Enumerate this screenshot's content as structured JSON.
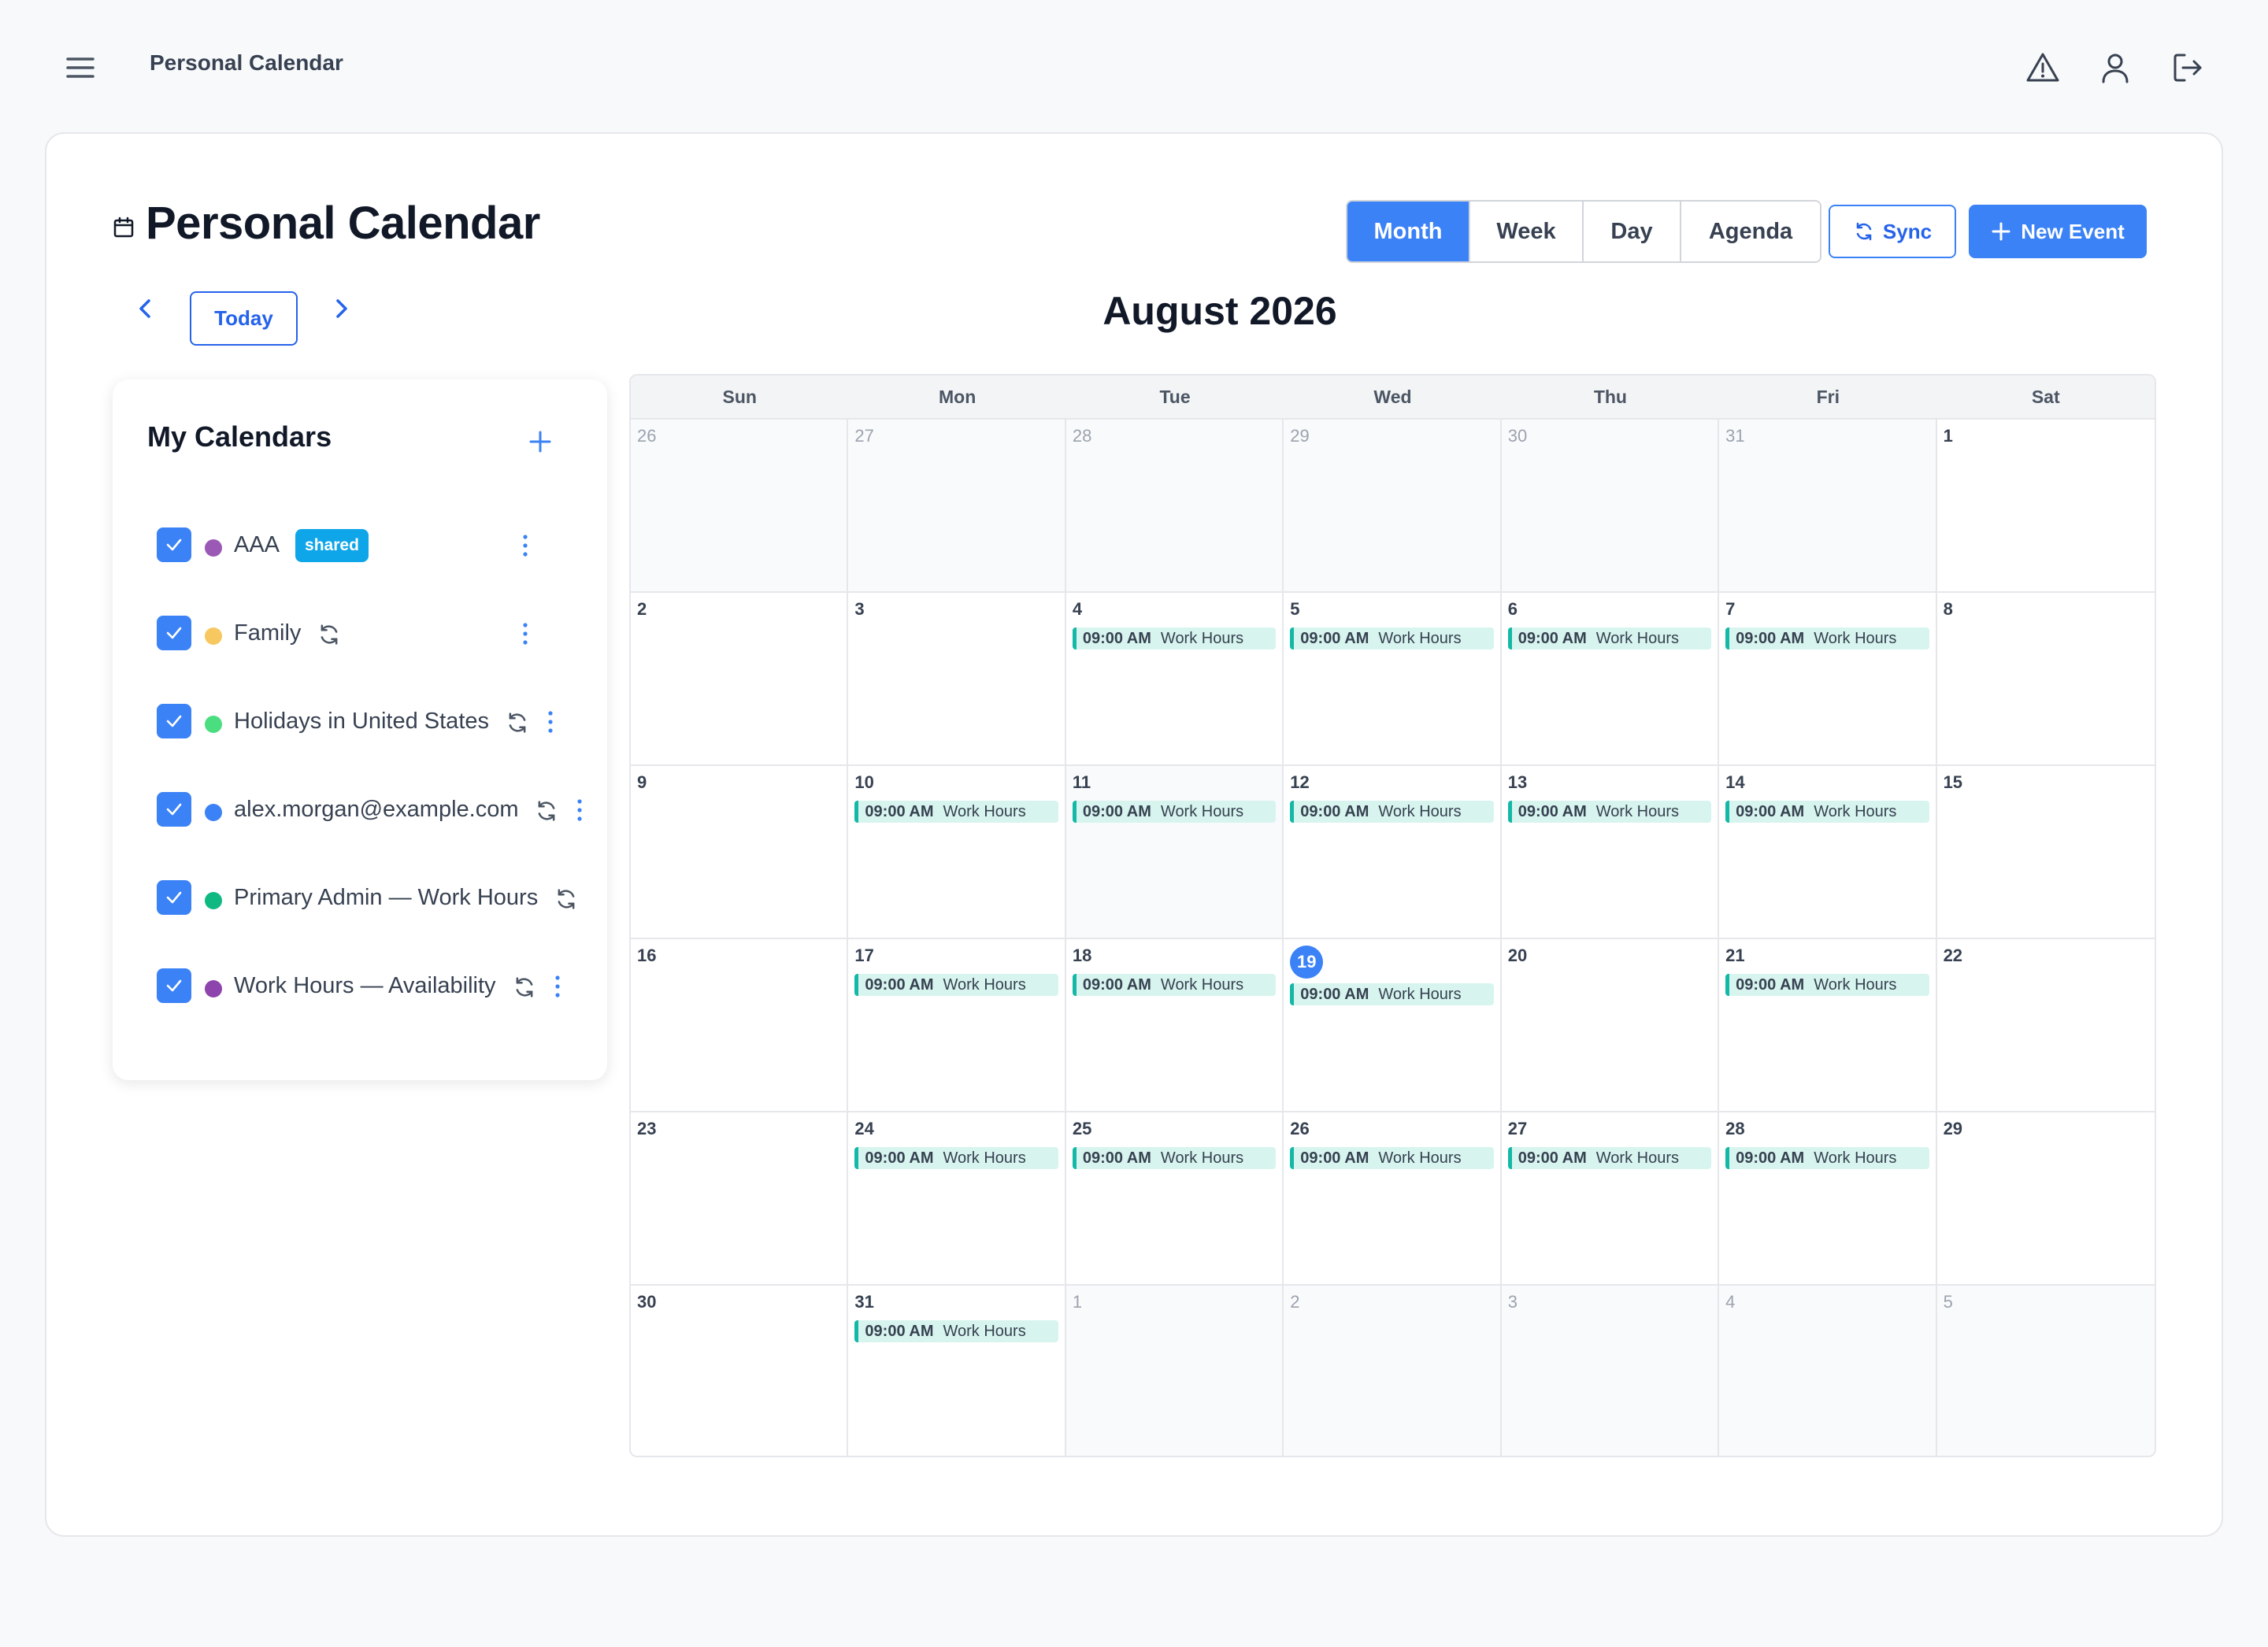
{
  "topbar": {
    "app_title": "Personal Calendar",
    "icons": [
      "menu-icon",
      "warning-icon",
      "user-icon",
      "logout-icon"
    ]
  },
  "header": {
    "page_title": "Personal Calendar",
    "today_label": "Today",
    "month_label": "August 2026",
    "views": [
      {
        "label": "Month",
        "active": true
      },
      {
        "label": "Week",
        "active": false
      },
      {
        "label": "Day",
        "active": false
      },
      {
        "label": "Agenda",
        "active": false
      }
    ],
    "sync_label": "Sync",
    "new_event_label": "New Event"
  },
  "sidebar": {
    "title": "My Calendars",
    "calendars": [
      {
        "name": "AAA",
        "color": "#9b59b6",
        "checked": true,
        "badge": "shared",
        "sync": false,
        "more": true
      },
      {
        "name": "Family",
        "color": "#f6c85f",
        "checked": true,
        "badge": null,
        "sync": true,
        "more": true
      },
      {
        "name": "Holidays in United States",
        "color": "#4ade80",
        "checked": true,
        "badge": null,
        "sync": true,
        "more": true
      },
      {
        "name": "alex.morgan@example.com",
        "color": "#3b82f6",
        "checked": true,
        "badge": null,
        "sync": true,
        "more": true
      },
      {
        "name": "Primary Admin — Work Hours",
        "color": "#10b981",
        "checked": true,
        "badge": null,
        "sync": true,
        "more": false
      },
      {
        "name": "Work Hours — Availability",
        "color": "#8e44ad",
        "checked": true,
        "badge": null,
        "sync": true,
        "more": true
      }
    ]
  },
  "calendar": {
    "weekdays": [
      "Sun",
      "Mon",
      "Tue",
      "Wed",
      "Thu",
      "Fri",
      "Sat"
    ],
    "today": 19,
    "event_time": "09:00 AM",
    "event_title": "Work Hours",
    "event_color": "#14b8a6",
    "days": [
      {
        "n": "26",
        "other": true,
        "ev": false
      },
      {
        "n": "27",
        "other": true,
        "ev": false
      },
      {
        "n": "28",
        "other": true,
        "ev": false
      },
      {
        "n": "29",
        "other": true,
        "ev": false
      },
      {
        "n": "30",
        "other": true,
        "ev": false
      },
      {
        "n": "31",
        "other": true,
        "ev": false
      },
      {
        "n": "1",
        "other": false,
        "ev": false
      },
      {
        "n": "2",
        "other": false,
        "ev": false
      },
      {
        "n": "3",
        "other": false,
        "ev": false
      },
      {
        "n": "4",
        "other": false,
        "ev": true
      },
      {
        "n": "5",
        "other": false,
        "ev": true
      },
      {
        "n": "6",
        "other": false,
        "ev": true
      },
      {
        "n": "7",
        "other": false,
        "ev": true
      },
      {
        "n": "8",
        "other": false,
        "ev": false
      },
      {
        "n": "9",
        "other": false,
        "ev": false
      },
      {
        "n": "10",
        "other": false,
        "ev": true
      },
      {
        "n": "11",
        "other": false,
        "ev": true,
        "shade": true
      },
      {
        "n": "12",
        "other": false,
        "ev": true
      },
      {
        "n": "13",
        "other": false,
        "ev": true
      },
      {
        "n": "14",
        "other": false,
        "ev": true
      },
      {
        "n": "15",
        "other": false,
        "ev": false
      },
      {
        "n": "16",
        "other": false,
        "ev": false
      },
      {
        "n": "17",
        "other": false,
        "ev": true
      },
      {
        "n": "18",
        "other": false,
        "ev": true
      },
      {
        "n": "19",
        "other": false,
        "ev": true,
        "today": true
      },
      {
        "n": "20",
        "other": false,
        "ev": false
      },
      {
        "n": "21",
        "other": false,
        "ev": true
      },
      {
        "n": "22",
        "other": false,
        "ev": false
      },
      {
        "n": "23",
        "other": false,
        "ev": false
      },
      {
        "n": "24",
        "other": false,
        "ev": true
      },
      {
        "n": "25",
        "other": false,
        "ev": true
      },
      {
        "n": "26",
        "other": false,
        "ev": true
      },
      {
        "n": "27",
        "other": false,
        "ev": true
      },
      {
        "n": "28",
        "other": false,
        "ev": true
      },
      {
        "n": "29",
        "other": false,
        "ev": false
      },
      {
        "n": "30",
        "other": false,
        "ev": false
      },
      {
        "n": "31",
        "other": false,
        "ev": true
      },
      {
        "n": "1",
        "other": true,
        "ev": false
      },
      {
        "n": "2",
        "other": true,
        "ev": false
      },
      {
        "n": "3",
        "other": true,
        "ev": false
      },
      {
        "n": "4",
        "other": true,
        "ev": false
      },
      {
        "n": "5",
        "other": true,
        "ev": false
      }
    ]
  }
}
